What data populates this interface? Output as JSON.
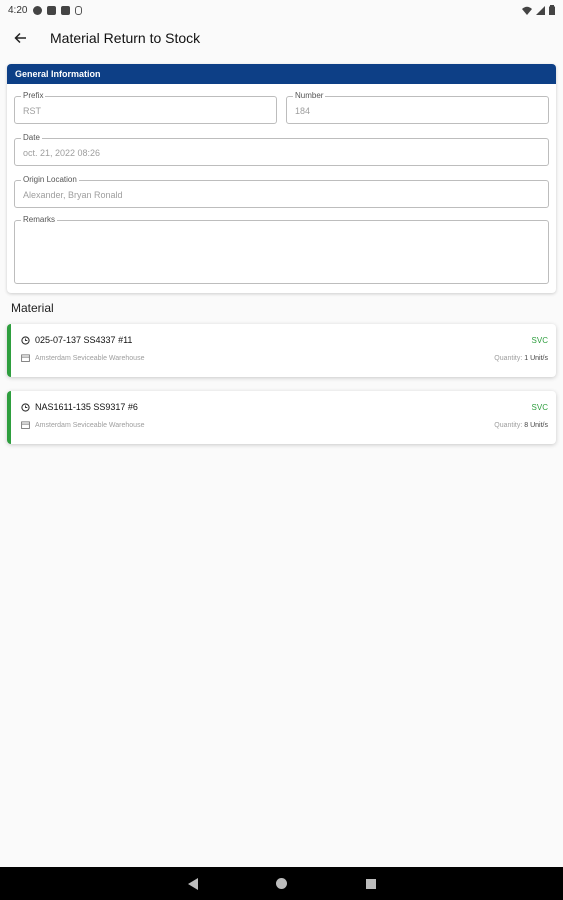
{
  "status_bar": {
    "time": "4:20"
  },
  "app_bar": {
    "title": "Material Return to Stock"
  },
  "general": {
    "header": "General Information",
    "prefix_label": "Prefix",
    "prefix_value": "RST",
    "number_label": "Number",
    "number_value": "184",
    "date_label": "Date",
    "date_value": "oct. 21, 2022 08:26",
    "origin_label": "Origin Location",
    "origin_value": "Alexander, Bryan Ronald",
    "remarks_label": "Remarks",
    "remarks_value": ""
  },
  "material": {
    "title": "Material",
    "items": [
      {
        "code": "025-07-137 SS4337 #11",
        "status": "SVC",
        "warehouse": "Amsterdam Seviceable Warehouse",
        "qty_label": "Quantity:",
        "qty_value": "1 Unit/s"
      },
      {
        "code": "NAS1611-135 SS9317 #6",
        "status": "SVC",
        "warehouse": "Amsterdam Seviceable Warehouse",
        "qty_label": "Quantity:",
        "qty_value": "8 Unit/s"
      }
    ]
  },
  "colors": {
    "header_blue": "#0d3f86",
    "svc_green": "#2e9e3e"
  },
  "icons": {
    "back": "arrow-left-icon",
    "item": "clock-icon",
    "warehouse": "warehouse-icon"
  }
}
